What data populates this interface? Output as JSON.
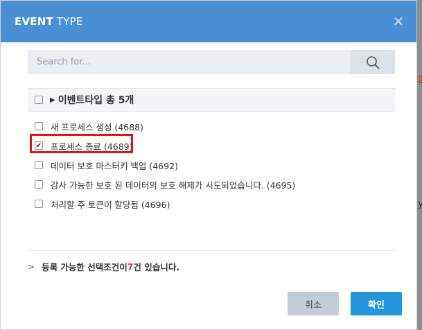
{
  "dialog": {
    "title_bold": "EVENT",
    "title_light": " TYPE",
    "close_symbol": "✕"
  },
  "search": {
    "placeholder": "Search for...",
    "icon": "search-icon"
  },
  "group": {
    "caret": "▶",
    "label": "이벤트타입 총 5개",
    "checked": false
  },
  "items": [
    {
      "label": "새 프로세스 생성 (4688)",
      "checked": false
    },
    {
      "label": "프로세스 종료 (4689)",
      "checked": true
    },
    {
      "label": "데이터 보호 마스터키 백업 (4692)",
      "checked": false
    },
    {
      "label": "감사 가능한 보호 된 데이터의 보호 해제가 시도되었습니다. (4695)",
      "checked": false
    },
    {
      "label": "처리할 주 토큰이 할당됨 (4696)",
      "checked": false
    }
  ],
  "summary": {
    "chevron": ">",
    "prefix": "등록 가능한 선택조건이 ",
    "count": "7",
    "suffix": "건 있습니다."
  },
  "buttons": {
    "cancel": "취소",
    "confirm": "확인"
  },
  "colors": {
    "header": "#4a8fd4",
    "confirm": "#2295dd",
    "highlight": "#e0141b",
    "count": "#d93434"
  }
}
